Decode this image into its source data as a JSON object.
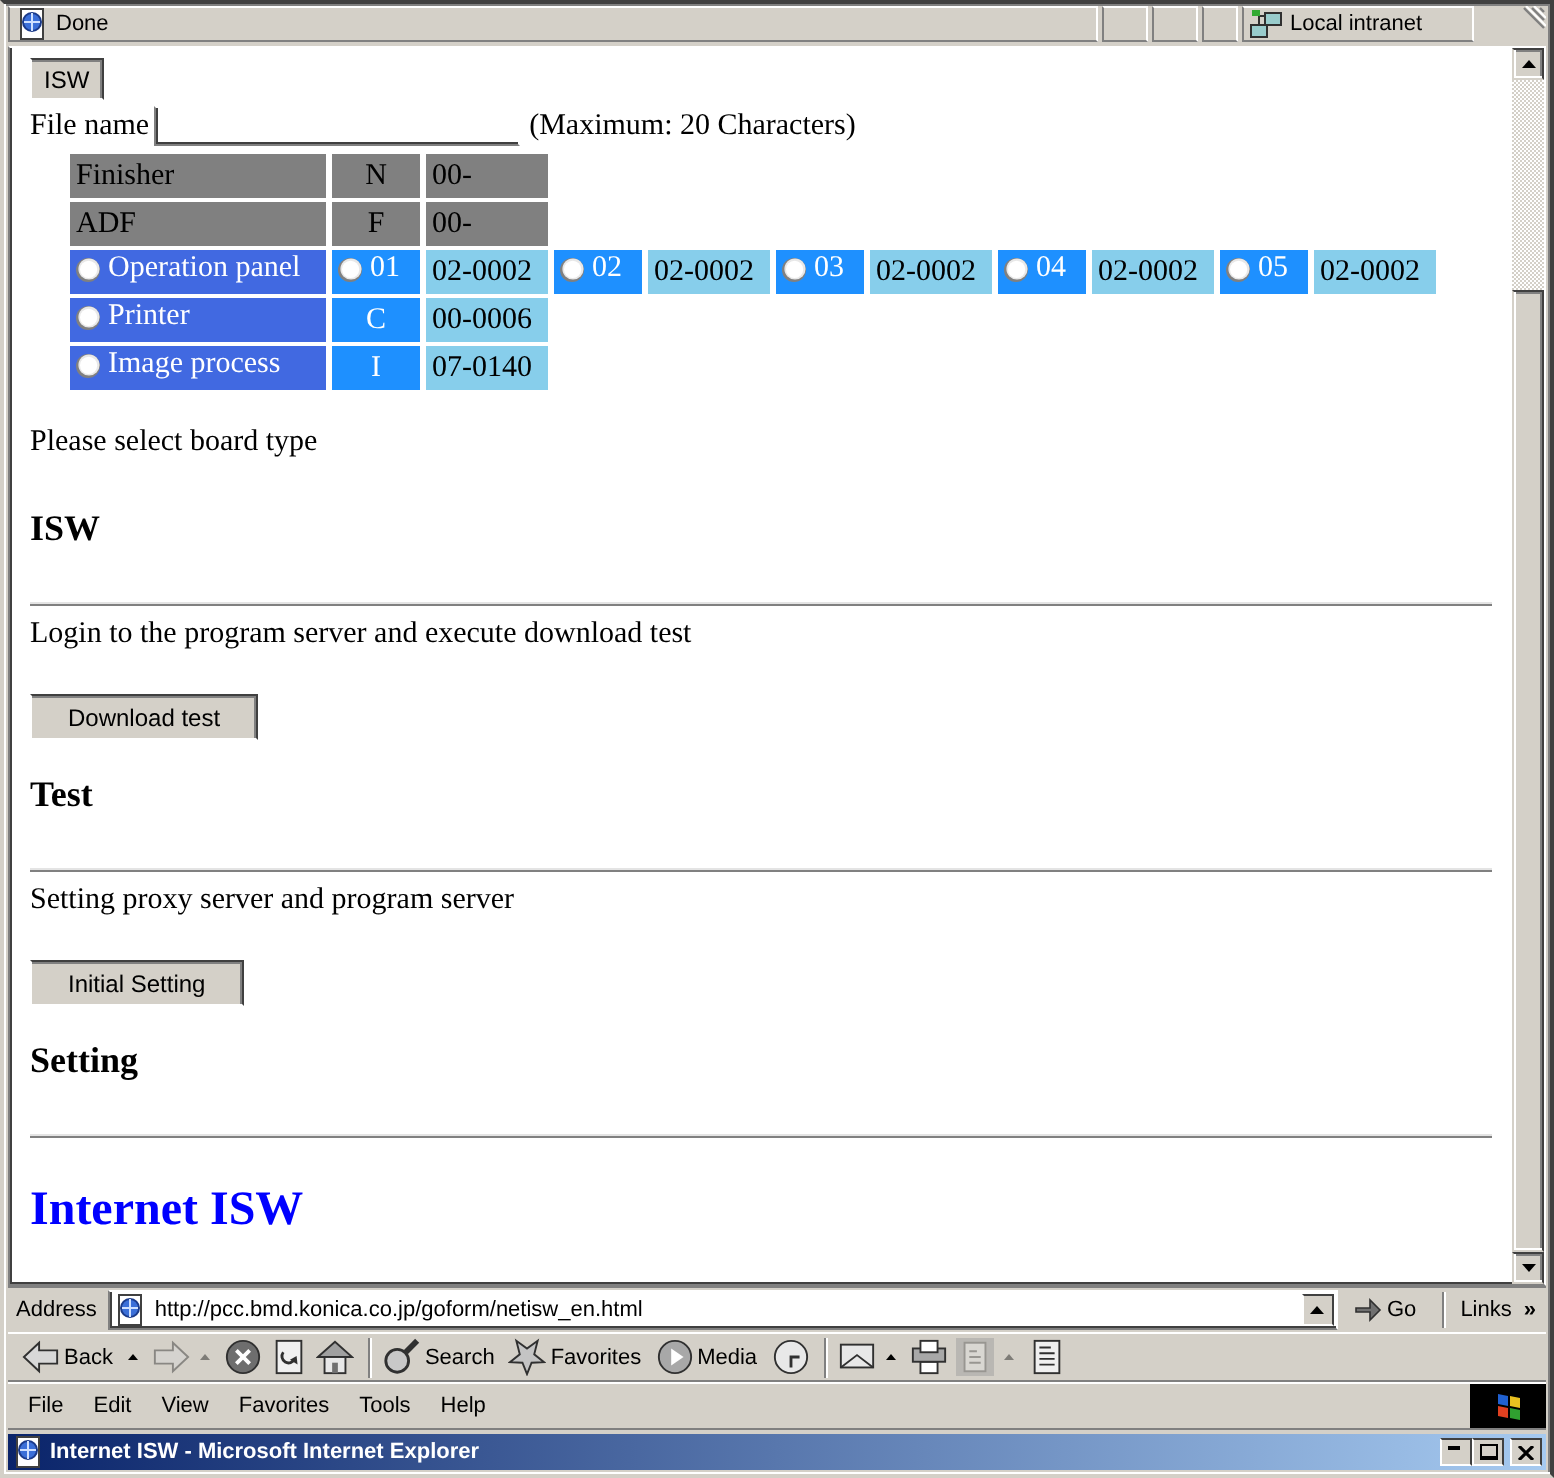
{
  "status_bar": {
    "text": "Done",
    "zone": "Local intranet"
  },
  "content": {
    "sections": [
      {
        "blocks": [
          {
            "kind": "button",
            "label": "ISW"
          },
          {
            "kind": "file_field",
            "label": "File name",
            "note": "(Maximum: 20 Characters)"
          },
          {
            "kind": "board_table",
            "rows": [
              {
                "name": "Finisher",
                "disabled": true,
                "cells": [
                  {
                    "kind": "code",
                    "text": "N"
                  },
                  {
                    "kind": "value",
                    "text": "00-"
                  }
                ]
              },
              {
                "name": "ADF",
                "disabled": true,
                "cells": [
                  {
                    "kind": "code",
                    "text": "F"
                  },
                  {
                    "kind": "value",
                    "text": "00-"
                  }
                ]
              },
              {
                "name": "Operation panel",
                "disabled": false,
                "selected": false,
                "cells": [
                  {
                    "kind": "option",
                    "text": "01",
                    "selected": false
                  },
                  {
                    "kind": "value",
                    "text": "02-0002"
                  },
                  {
                    "kind": "option",
                    "text": "02",
                    "selected": false
                  },
                  {
                    "kind": "value",
                    "text": "02-0002"
                  },
                  {
                    "kind": "option",
                    "text": "03",
                    "selected": false
                  },
                  {
                    "kind": "value",
                    "text": "02-0002"
                  },
                  {
                    "kind": "option",
                    "text": "04",
                    "selected": false
                  },
                  {
                    "kind": "value",
                    "text": "02-0002"
                  },
                  {
                    "kind": "option",
                    "text": "05",
                    "selected": false
                  },
                  {
                    "kind": "value",
                    "text": "02-0002"
                  }
                ]
              },
              {
                "name": "Printer",
                "disabled": false,
                "selected": false,
                "cells": [
                  {
                    "kind": "code",
                    "text": "C"
                  },
                  {
                    "kind": "value",
                    "text": "00-0006"
                  }
                ]
              },
              {
                "name": "Image process",
                "disabled": false,
                "selected": false,
                "cells": [
                  {
                    "kind": "code",
                    "text": "I"
                  },
                  {
                    "kind": "value",
                    "text": "07-0140"
                  }
                ]
              }
            ]
          },
          {
            "kind": "text",
            "text": "Please select board type"
          },
          {
            "kind": "heading",
            "text": "ISW"
          }
        ]
      },
      {
        "blocks": [
          {
            "kind": "text",
            "text": "Login to the program server and execute download test"
          },
          {
            "kind": "button",
            "label": "Download test"
          },
          {
            "kind": "heading",
            "text": "Test"
          }
        ]
      },
      {
        "blocks": [
          {
            "kind": "text",
            "text": "Setting proxy server and program server"
          },
          {
            "kind": "button",
            "label": "Initial Setting"
          },
          {
            "kind": "heading",
            "text": "Setting"
          }
        ]
      }
    ],
    "title": "Internet ISW"
  },
  "address_bar": {
    "label": "Address",
    "url": "http://pcc.bmd.konica.co.jp/goform/netisw_en.html",
    "go": "Go",
    "links": "Links",
    "links_chevron": "»"
  },
  "toolbar": {
    "groups": [
      [
        {
          "kind": "back",
          "label": "Back",
          "dropdown": true,
          "disabled": false
        },
        {
          "kind": "forward",
          "dropdown": true,
          "disabled": true
        },
        {
          "kind": "stop",
          "dropdown": false,
          "disabled": false
        },
        {
          "kind": "refresh",
          "dropdown": false,
          "disabled": false
        },
        {
          "kind": "home",
          "dropdown": false,
          "disabled": false
        }
      ],
      [
        {
          "kind": "search",
          "label": "Search",
          "dropdown": false,
          "disabled": false
        },
        {
          "kind": "favorites",
          "label": "Favorites",
          "dropdown": false,
          "disabled": false
        },
        {
          "kind": "media",
          "label": "Media",
          "dropdown": false,
          "disabled": false
        },
        {
          "kind": "history",
          "dropdown": false,
          "disabled": false
        }
      ],
      [
        {
          "kind": "mail",
          "dropdown": true,
          "disabled": false
        },
        {
          "kind": "print",
          "dropdown": false,
          "disabled": false
        },
        {
          "kind": "edit",
          "dropdown": true,
          "disabled": true
        },
        {
          "kind": "discuss",
          "dropdown": false,
          "disabled": false
        }
      ]
    ]
  },
  "menu_bar": {
    "items": [
      "File",
      "Edit",
      "View",
      "Favorites",
      "Tools",
      "Help"
    ]
  },
  "window": {
    "title": "Internet ISW - Microsoft Internet Explorer"
  }
}
